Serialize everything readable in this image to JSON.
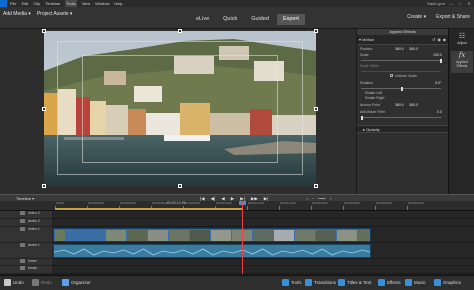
{
  "titlebar": {
    "menus": [
      "File",
      "Edit",
      "Clip",
      "Timeline",
      "Tools",
      "View",
      "Window",
      "Help"
    ],
    "active_menu": "Tools",
    "user": "Gadi Lynn",
    "window_buttons": [
      "—",
      "□",
      "✕"
    ]
  },
  "modebar": {
    "add_media": "Add Media ▾",
    "project_assets": "Project Assets ▾",
    "modes": [
      "eLive",
      "Quick",
      "Guided",
      "Expert"
    ],
    "selected_mode": "Expert",
    "create": "Create ▾",
    "export_share": "Export & Share"
  },
  "effects_panel": {
    "title": "Applied Effects",
    "motion_label": "Motion",
    "properties": [
      {
        "label": "Position",
        "v1": "360.0",
        "v2": "360.0"
      },
      {
        "label": "Scale",
        "v1": "100.0"
      },
      {
        "label": "Scale Width",
        "v1": ""
      },
      {
        "label": "Uniform Scale",
        "v1": ""
      },
      {
        "label": "Rotation",
        "v1": "0.0°"
      },
      {
        "label": "Rotate Left",
        "v1": ""
      },
      {
        "label": "Rotate Right",
        "v1": ""
      },
      {
        "label": "Anchor Point",
        "v1": "360.0",
        "v2": "360.0"
      },
      {
        "label": "Anti-flicker Filter",
        "v1": "0.0"
      }
    ],
    "opacity_label": "Opacity"
  },
  "right_strip": [
    {
      "label": "Adjust",
      "icon": "adjust-icon",
      "glyph": "☷"
    },
    {
      "label": "Applied Effects",
      "icon": "fx-icon",
      "glyph": "fx"
    }
  ],
  "timeline": {
    "label": "Timeline ▾",
    "timecode": "00;00;12;29",
    "ruler_labels": [
      "00;00",
      "00;00;02;00",
      "00;00;04;00",
      "00;00;06;00",
      "00;00;08;00",
      "00;00;10;00",
      "00;00;12;00",
      "00;00;14;00",
      "00;00;16;00",
      "00;00;18;00",
      "00;00;20;00",
      "00;00;22;00"
    ],
    "transport": [
      "|◀",
      "◀|",
      "◀",
      "▶",
      "▶|",
      "▶▶",
      "▶|"
    ],
    "tracks": [
      {
        "name": "Video 2",
        "kind": "video"
      },
      {
        "name": "Audio 2",
        "kind": "audio"
      },
      {
        "name": "Video 1",
        "kind": "video"
      },
      {
        "name": "Audio 1",
        "kind": "audio"
      },
      {
        "name": "Voice",
        "kind": "audio"
      },
      {
        "name": "Music",
        "kind": "audio"
      }
    ]
  },
  "bottombar": {
    "left": [
      {
        "label": "Undo",
        "icon": "undo-icon",
        "color": "#c9c9c9"
      },
      {
        "label": "Redo",
        "icon": "redo-icon",
        "color": "#777777"
      },
      {
        "label": "Organizer",
        "icon": "organizer-icon",
        "color": "#5aa1e8"
      }
    ],
    "right": [
      {
        "label": "Tools",
        "icon": "tools-icon",
        "color": "#3a8fd6"
      },
      {
        "label": "Transitions",
        "icon": "transitions-icon",
        "color": "#3a8fd6"
      },
      {
        "label": "Titles & Text",
        "icon": "titles-icon",
        "color": "#3a8fd6"
      },
      {
        "label": "Effects",
        "icon": "effects-icon",
        "color": "#3a8fd6"
      },
      {
        "label": "Music",
        "icon": "music-icon",
        "color": "#3a8fd6"
      },
      {
        "label": "Graphics",
        "icon": "graphics-icon",
        "color": "#3a8fd6"
      }
    ]
  }
}
